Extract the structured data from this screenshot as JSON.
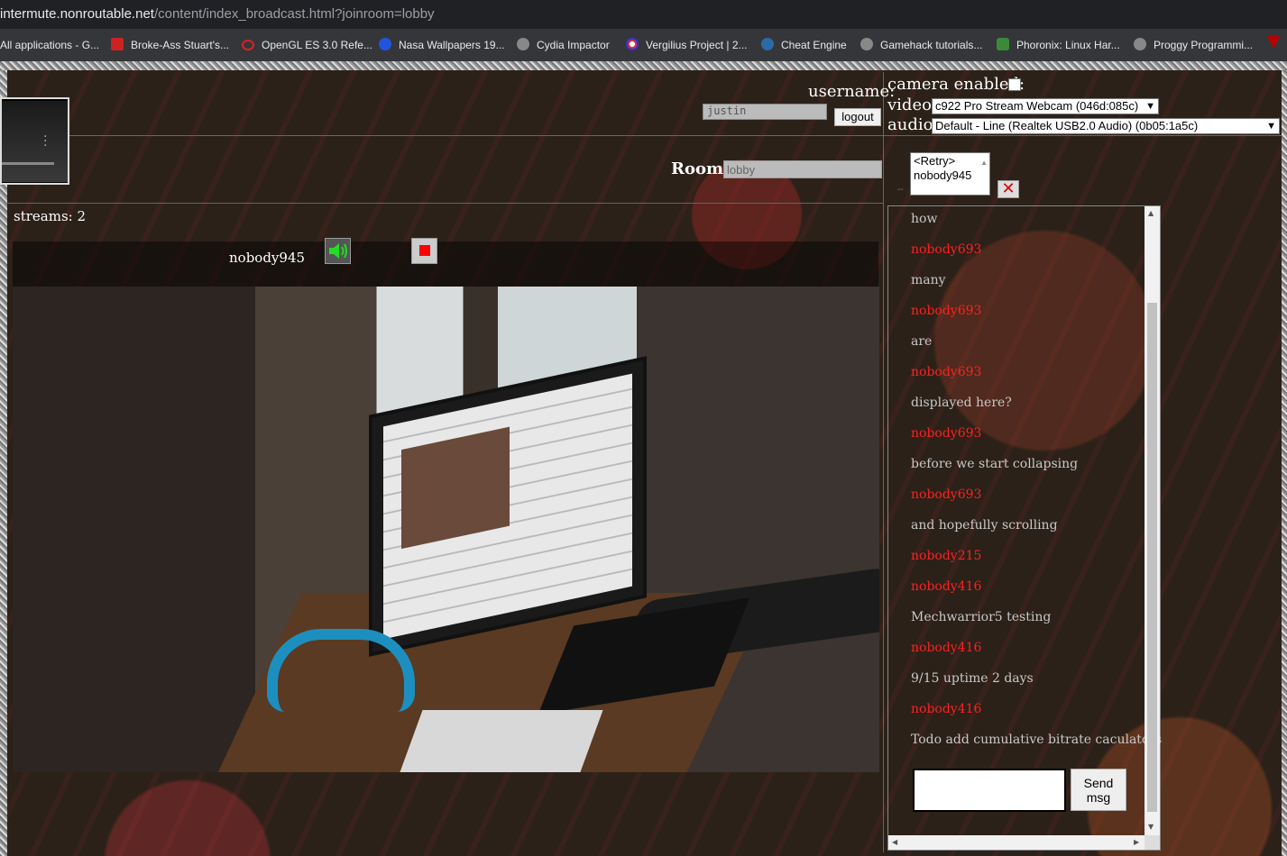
{
  "browser": {
    "url_host": "intermute.nonroutable.net",
    "url_path": "/content/index_broadcast.html?joinroom=lobby",
    "bookmarks": [
      {
        "label": "All applications - G...",
        "icon": "grid-icon"
      },
      {
        "label": "Broke-Ass Stuart's...",
        "icon": "dollar-icon"
      },
      {
        "label": "OpenGL ES 3.0 Refe...",
        "icon": "opengl-icon"
      },
      {
        "label": "Nasa Wallpapers 19...",
        "icon": "nasa-icon"
      },
      {
        "label": "Cydia Impactor",
        "icon": "globe-icon"
      },
      {
        "label": "Vergilius Project | 2...",
        "icon": "vergilius-icon"
      },
      {
        "label": "Cheat Engine",
        "icon": "cheat-engine-icon"
      },
      {
        "label": "Gamehack tutorials...",
        "icon": "globe-icon"
      },
      {
        "label": "Phoronix: Linux Har...",
        "icon": "phoronix-icon"
      },
      {
        "label": "Proggy Programmi...",
        "icon": "globe-icon"
      }
    ]
  },
  "header": {
    "username_label": "username:",
    "username_value": "justin",
    "logout_label": "logout",
    "camera_label": "camera enabled:",
    "video_label": "video:",
    "video_selected": "c922 Pro Stream Webcam (046d:085c)",
    "audio_label": "audio:",
    "audio_selected": "Default - Line (Realtek USB2.0 Audio) (0b05:1a5c)"
  },
  "room": {
    "label": "Room:",
    "placeholder": "lobby",
    "users": [
      "<Retry>",
      "nobody945"
    ]
  },
  "streams": {
    "label": "streams:",
    "count": "2",
    "items": [
      {
        "name": "nobody945"
      }
    ]
  },
  "chat": {
    "messages": [
      {
        "kind": "text",
        "value": "how"
      },
      {
        "kind": "user",
        "value": "nobody693"
      },
      {
        "kind": "text",
        "value": "many"
      },
      {
        "kind": "user",
        "value": "nobody693"
      },
      {
        "kind": "text",
        "value": "are"
      },
      {
        "kind": "user",
        "value": "nobody693"
      },
      {
        "kind": "text",
        "value": "displayed here?"
      },
      {
        "kind": "user",
        "value": "nobody693"
      },
      {
        "kind": "text",
        "value": "before we start collapsing"
      },
      {
        "kind": "user",
        "value": "nobody693"
      },
      {
        "kind": "text",
        "value": "and hopefully scrolling"
      },
      {
        "kind": "user",
        "value": "nobody215"
      },
      {
        "kind": "user",
        "value": "nobody416"
      },
      {
        "kind": "text",
        "value": "Mechwarrior5 testing"
      },
      {
        "kind": "user",
        "value": "nobody416"
      },
      {
        "kind": "text",
        "value": "9/15 uptime 2 days"
      },
      {
        "kind": "user",
        "value": "nobody416"
      },
      {
        "kind": "text",
        "value": "Todo add cumulative bitrate caculators"
      }
    ],
    "send_label_line1": "Send",
    "send_label_line2": "msg"
  },
  "colors": {
    "chat_user": "#ff2020",
    "chat_text": "#c8c8c8",
    "audio_icon": "#22dd22",
    "stop_icon": "#ff0000"
  }
}
